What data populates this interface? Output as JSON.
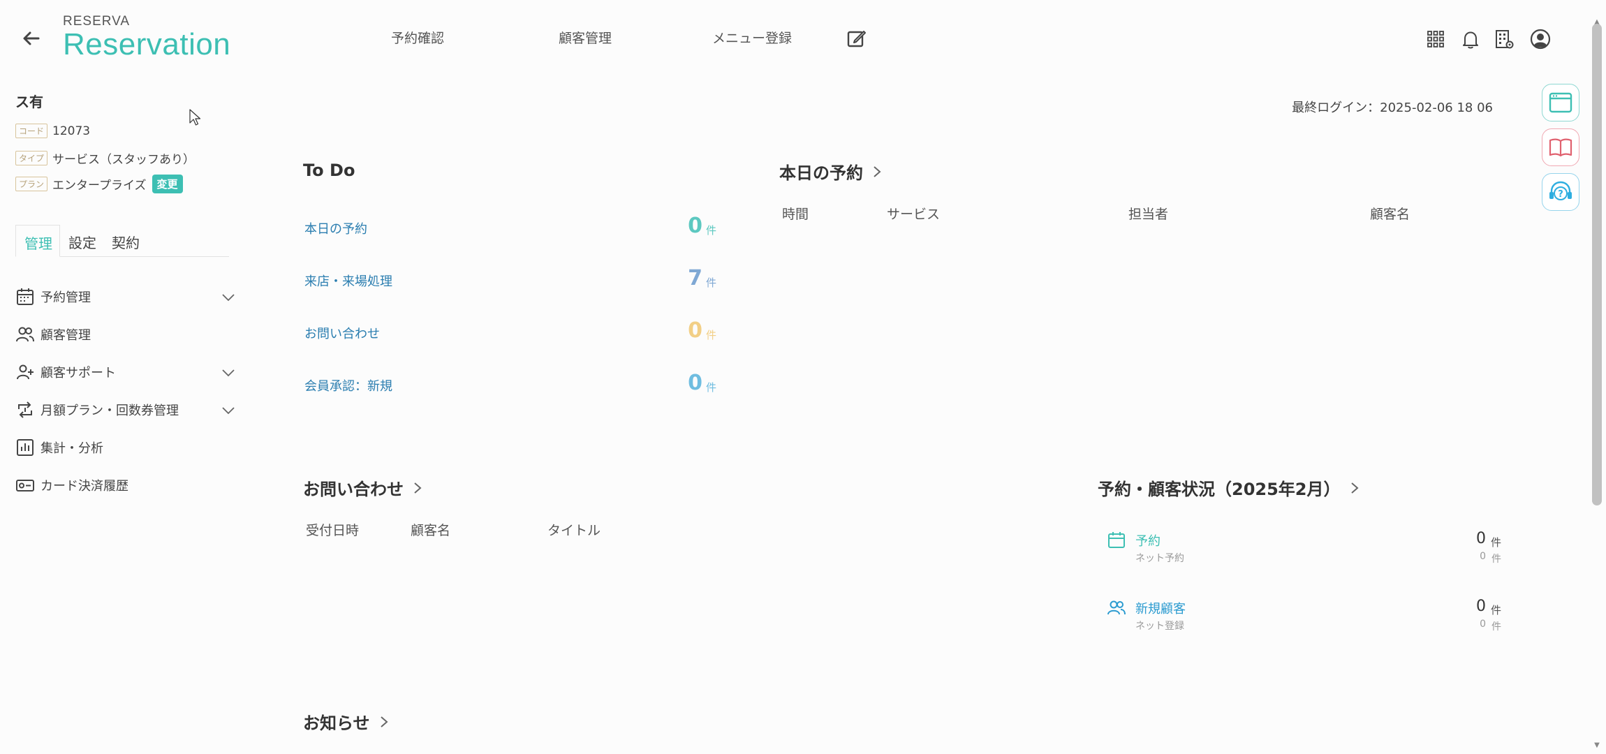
{
  "header": {
    "logo_top": "RESERVA",
    "logo_main": "Reservation",
    "nav": [
      "予約確認",
      "顧客管理",
      "メニュー登録"
    ]
  },
  "sidebar": {
    "store_name": "ス有",
    "code_tag": "コード",
    "code_value": "12073",
    "type_tag": "タイプ",
    "type_value": "サービス（スタッフあり）",
    "plan_tag": "プラン",
    "plan_value": "エンタープライズ",
    "change_label": "変更",
    "tabs": [
      "管理",
      "設定",
      "契約"
    ],
    "items": [
      {
        "label": "予約管理",
        "icon": "calendar-icon",
        "expandable": true
      },
      {
        "label": "顧客管理",
        "icon": "users-icon",
        "expandable": false
      },
      {
        "label": "顧客サポート",
        "icon": "user-plus-icon",
        "expandable": true
      },
      {
        "label": "月額プラン・回数券管理",
        "icon": "repeat-icon",
        "expandable": true
      },
      {
        "label": "集計・分析",
        "icon": "chart-icon",
        "expandable": false
      },
      {
        "label": "カード決済履歴",
        "icon": "card-icon",
        "expandable": false
      }
    ]
  },
  "main": {
    "last_login": "最終ログイン：2025-02-06 18 06",
    "todo": {
      "title": "To Do",
      "rows": [
        {
          "label": "本日の予約",
          "value": "0",
          "unit": "件",
          "color": "#5cc8c0"
        },
        {
          "label": "来店・来場処理",
          "value": "7",
          "unit": "件",
          "color": "#7fa8d4"
        },
        {
          "label": "お問い合わせ",
          "value": "0",
          "unit": "件",
          "color": "#f2cf86"
        },
        {
          "label": "会員承認：新規",
          "value": "0",
          "unit": "件",
          "color": "#6fbde0"
        }
      ]
    },
    "today": {
      "title": "本日の予約",
      "columns": [
        "時間",
        "サービス",
        "担当者",
        "顧客名"
      ]
    },
    "inquiry": {
      "title": "お問い合わせ",
      "columns": [
        "受付日時",
        "顧客名",
        "タイトル"
      ]
    },
    "status": {
      "title": "予約・顧客状況（2025年2月）",
      "rows": [
        {
          "label": "予約",
          "sub": "ネット予約",
          "value": "0",
          "unit": "件",
          "subvalue": "0",
          "subunit": "件"
        },
        {
          "label": "新規顧客",
          "sub": "ネット登録",
          "value": "0",
          "unit": "件",
          "subvalue": "0",
          "subunit": "件"
        }
      ]
    },
    "notice": {
      "title": "お知らせ"
    }
  },
  "colors": {
    "accent": "#3dbfb3",
    "link": "#2b7eb0"
  }
}
